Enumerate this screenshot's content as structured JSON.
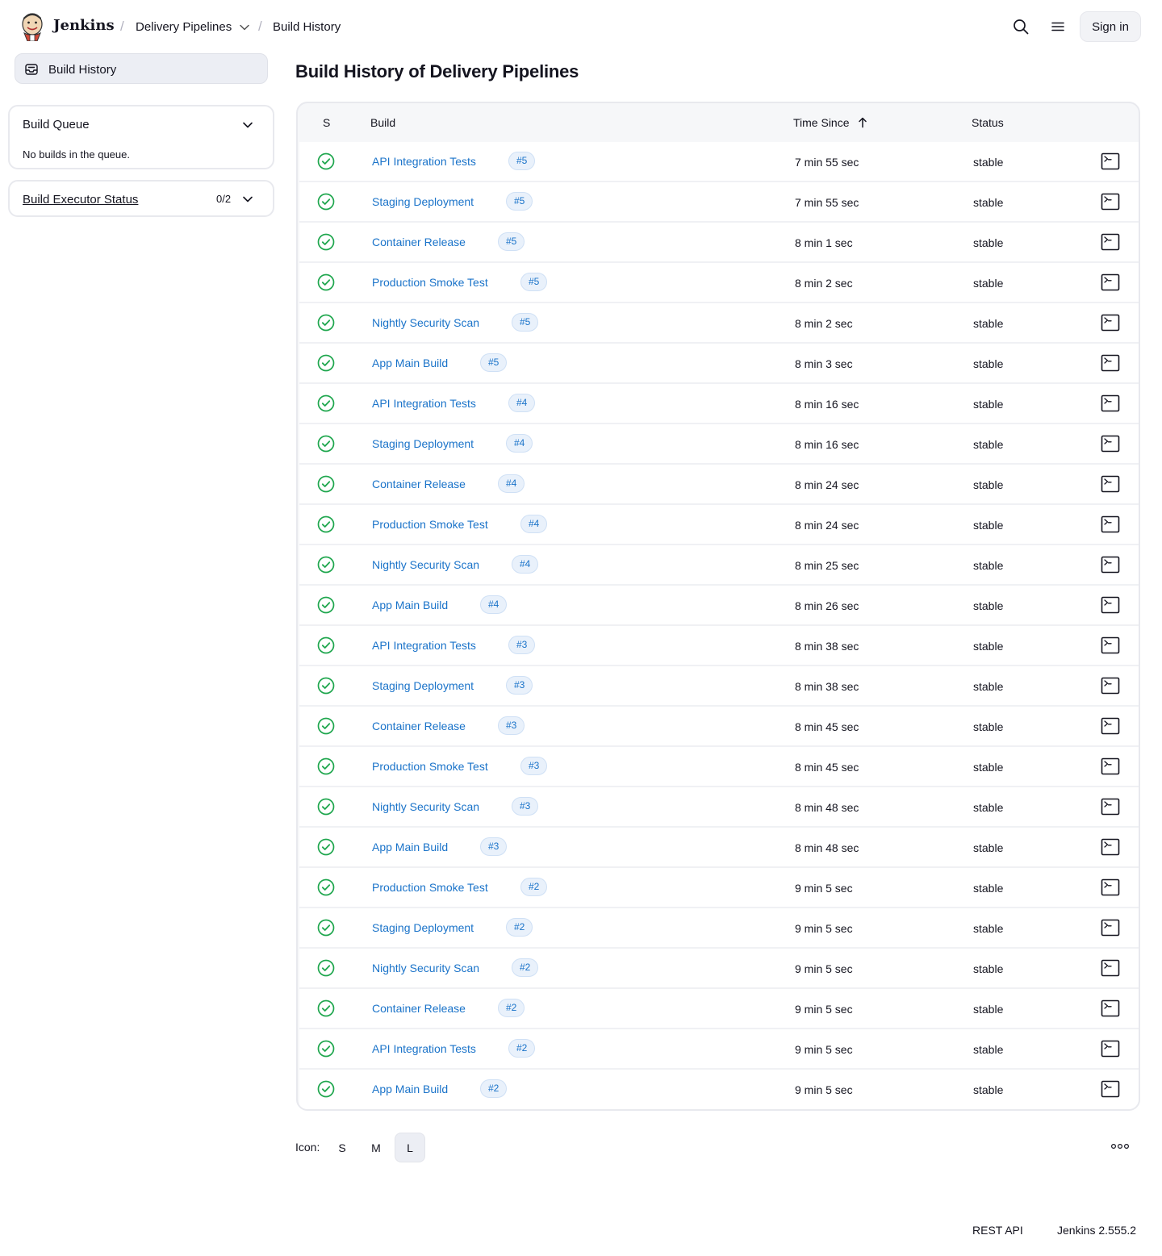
{
  "header": {
    "brand": "Jenkins",
    "breadcrumb": [
      "Delivery Pipelines",
      "Build History"
    ],
    "sign_in": "Sign in"
  },
  "sidebar": {
    "active_item": "Build History",
    "build_queue": {
      "title": "Build Queue",
      "message": "No builds in the queue."
    },
    "executor": {
      "title": "Build Executor Status",
      "count": "0/2"
    }
  },
  "main": {
    "title": "Build History of Delivery Pipelines",
    "columns": {
      "s": "S",
      "build": "Build",
      "time_since": "Time Since",
      "status": "Status"
    },
    "builds": [
      {
        "job": "API Integration Tests",
        "number": "#5",
        "time": "7 min 55 sec",
        "status": "stable"
      },
      {
        "job": "Staging Deployment",
        "number": "#5",
        "time": "7 min 55 sec",
        "status": "stable"
      },
      {
        "job": "Container Release",
        "number": "#5",
        "time": "8 min 1 sec",
        "status": "stable"
      },
      {
        "job": "Production Smoke Test",
        "number": "#5",
        "time": "8 min 2 sec",
        "status": "stable"
      },
      {
        "job": "Nightly Security Scan",
        "number": "#5",
        "time": "8 min 2 sec",
        "status": "stable"
      },
      {
        "job": "App Main Build",
        "number": "#5",
        "time": "8 min 3 sec",
        "status": "stable"
      },
      {
        "job": "API Integration Tests",
        "number": "#4",
        "time": "8 min 16 sec",
        "status": "stable"
      },
      {
        "job": "Staging Deployment",
        "number": "#4",
        "time": "8 min 16 sec",
        "status": "stable"
      },
      {
        "job": "Container Release",
        "number": "#4",
        "time": "8 min 24 sec",
        "status": "stable"
      },
      {
        "job": "Production Smoke Test",
        "number": "#4",
        "time": "8 min 24 sec",
        "status": "stable"
      },
      {
        "job": "Nightly Security Scan",
        "number": "#4",
        "time": "8 min 25 sec",
        "status": "stable"
      },
      {
        "job": "App Main Build",
        "number": "#4",
        "time": "8 min 26 sec",
        "status": "stable"
      },
      {
        "job": "API Integration Tests",
        "number": "#3",
        "time": "8 min 38 sec",
        "status": "stable"
      },
      {
        "job": "Staging Deployment",
        "number": "#3",
        "time": "8 min 38 sec",
        "status": "stable"
      },
      {
        "job": "Container Release",
        "number": "#3",
        "time": "8 min 45 sec",
        "status": "stable"
      },
      {
        "job": "Production Smoke Test",
        "number": "#3",
        "time": "8 min 45 sec",
        "status": "stable"
      },
      {
        "job": "Nightly Security Scan",
        "number": "#3",
        "time": "8 min 48 sec",
        "status": "stable"
      },
      {
        "job": "App Main Build",
        "number": "#3",
        "time": "8 min 48 sec",
        "status": "stable"
      },
      {
        "job": "Production Smoke Test",
        "number": "#2",
        "time": "9 min 5 sec",
        "status": "stable"
      },
      {
        "job": "Staging Deployment",
        "number": "#2",
        "time": "9 min 5 sec",
        "status": "stable"
      },
      {
        "job": "Nightly Security Scan",
        "number": "#2",
        "time": "9 min 5 sec",
        "status": "stable"
      },
      {
        "job": "Container Release",
        "number": "#2",
        "time": "9 min 5 sec",
        "status": "stable"
      },
      {
        "job": "API Integration Tests",
        "number": "#2",
        "time": "9 min 5 sec",
        "status": "stable"
      },
      {
        "job": "App Main Build",
        "number": "#2",
        "time": "9 min 5 sec",
        "status": "stable"
      }
    ],
    "icon_size": {
      "label": "Icon:",
      "options": [
        "S",
        "M",
        "L"
      ],
      "selected": "L"
    }
  },
  "footer": {
    "rest_api": "REST API",
    "version": "Jenkins 2.555.2"
  },
  "colors": {
    "link": "#1a73c9",
    "success": "#1ea64d",
    "badge_bg": "#e9f1fb"
  },
  "icons": {
    "logo": "jenkins-logo-icon",
    "search": "search-icon",
    "menu": "hamburger-menu-icon",
    "sidebar": "build-history-inbox-icon",
    "status": "check-circle-icon",
    "console": "terminal-icon",
    "sort": "arrow-up-icon",
    "more": "ellipsis-icon"
  }
}
